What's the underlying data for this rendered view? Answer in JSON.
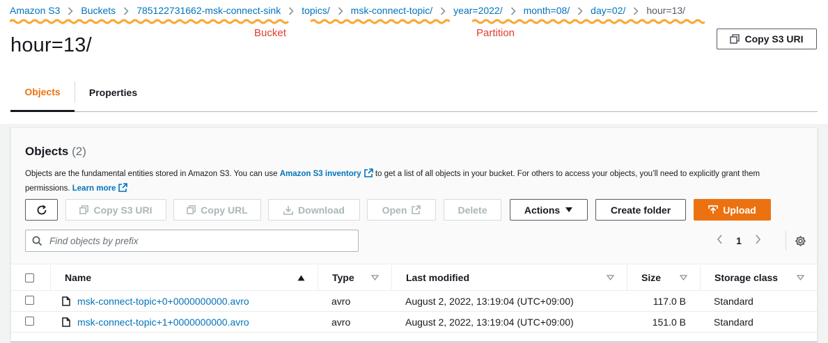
{
  "breadcrumb": {
    "items": [
      "Amazon S3",
      "Buckets",
      "785122731662-msk-connect-sink",
      "topics/",
      "msk-connect-topic/",
      "year=2022/",
      "month=08/",
      "day=02/"
    ],
    "current": "hour=13/"
  },
  "annotations": {
    "bucket": "Bucket",
    "partition": "Partition",
    "color": "#e03c2e",
    "squiggle_color": "#f7a836"
  },
  "page": {
    "title": "hour=13/",
    "copy_s3_uri_label": "Copy S3 URI"
  },
  "tabs": [
    {
      "label": "Objects",
      "active": true
    },
    {
      "label": "Properties",
      "active": false
    }
  ],
  "panel": {
    "title": "Objects",
    "count": "(2)",
    "desc_part1": "Objects are the fundamental entities stored in Amazon S3. You can use ",
    "desc_link1": "Amazon S3 inventory",
    "desc_part2": " to get a list of all objects in your bucket. For others to access your objects, you’ll need to explicitly grant them permissions. ",
    "desc_link2": "Learn more"
  },
  "toolbar": {
    "copy_s3_uri": "Copy S3 URI",
    "copy_url": "Copy URL",
    "download": "Download",
    "open": "Open",
    "delete": "Delete",
    "actions": "Actions",
    "create_folder": "Create folder",
    "upload": "Upload"
  },
  "search": {
    "placeholder": "Find objects by prefix",
    "value": ""
  },
  "pagination": {
    "page": "1"
  },
  "table": {
    "columns": [
      "Name",
      "Type",
      "Last modified",
      "Size",
      "Storage class"
    ],
    "rows": [
      {
        "name": "msk-connect-topic+0+0000000000.avro",
        "type": "avro",
        "modified": "August 2, 2022, 13:19:04 (UTC+09:00)",
        "size": "117.0 B",
        "storage": "Standard"
      },
      {
        "name": "msk-connect-topic+1+0000000000.avro",
        "type": "avro",
        "modified": "August 2, 2022, 13:19:04 (UTC+09:00)",
        "size": "151.0 B",
        "storage": "Standard"
      }
    ]
  },
  "colors": {
    "accent": "#ec7211",
    "link": "#0073bb",
    "text": "#16191f"
  },
  "icons": [
    "refresh-icon",
    "copy-icon",
    "download-icon",
    "external-link-icon",
    "caret-down-icon",
    "upload-icon",
    "search-icon",
    "chevron-left-icon",
    "chevron-right-icon",
    "gear-icon",
    "file-icon",
    "sort-asc-icon",
    "sort-desc-icon"
  ]
}
